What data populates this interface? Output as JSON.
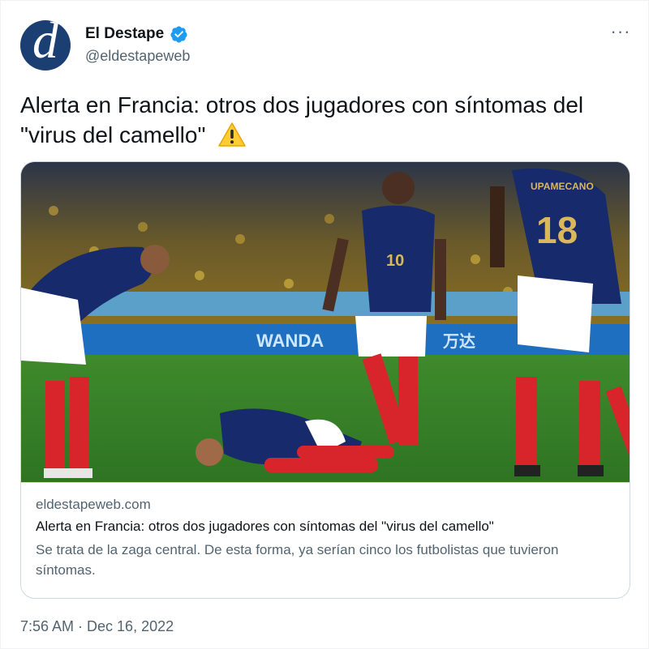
{
  "account": {
    "name": "El Destape",
    "handle": "@eldestapeweb",
    "avatar_letter": "d",
    "verified_color": "#1d9bf0"
  },
  "tweet": {
    "text": "Alerta en Francia: otros dos jugadores con síntomas del \"virus del camello\"",
    "timestamp": "7:56 AM · Dec 16, 2022"
  },
  "card": {
    "domain": "eldestapeweb.com",
    "title": "Alerta en Francia: otros dos jugadores con síntomas del \"virus del camello\"",
    "description": "Se trata de la zaga central. De esta forma, ya serían cinco los futbolistas que tuvieron síntomas."
  },
  "photo": {
    "board_text_1": "WANDA",
    "board_text_2": "万达",
    "jersey_10": "10",
    "jersey_18": "18",
    "jersey_name": "UPAMECANO"
  },
  "icons": {
    "more": "more-icon",
    "verified": "verified-badge-icon",
    "warning": "warning-icon"
  },
  "more_label": "···"
}
